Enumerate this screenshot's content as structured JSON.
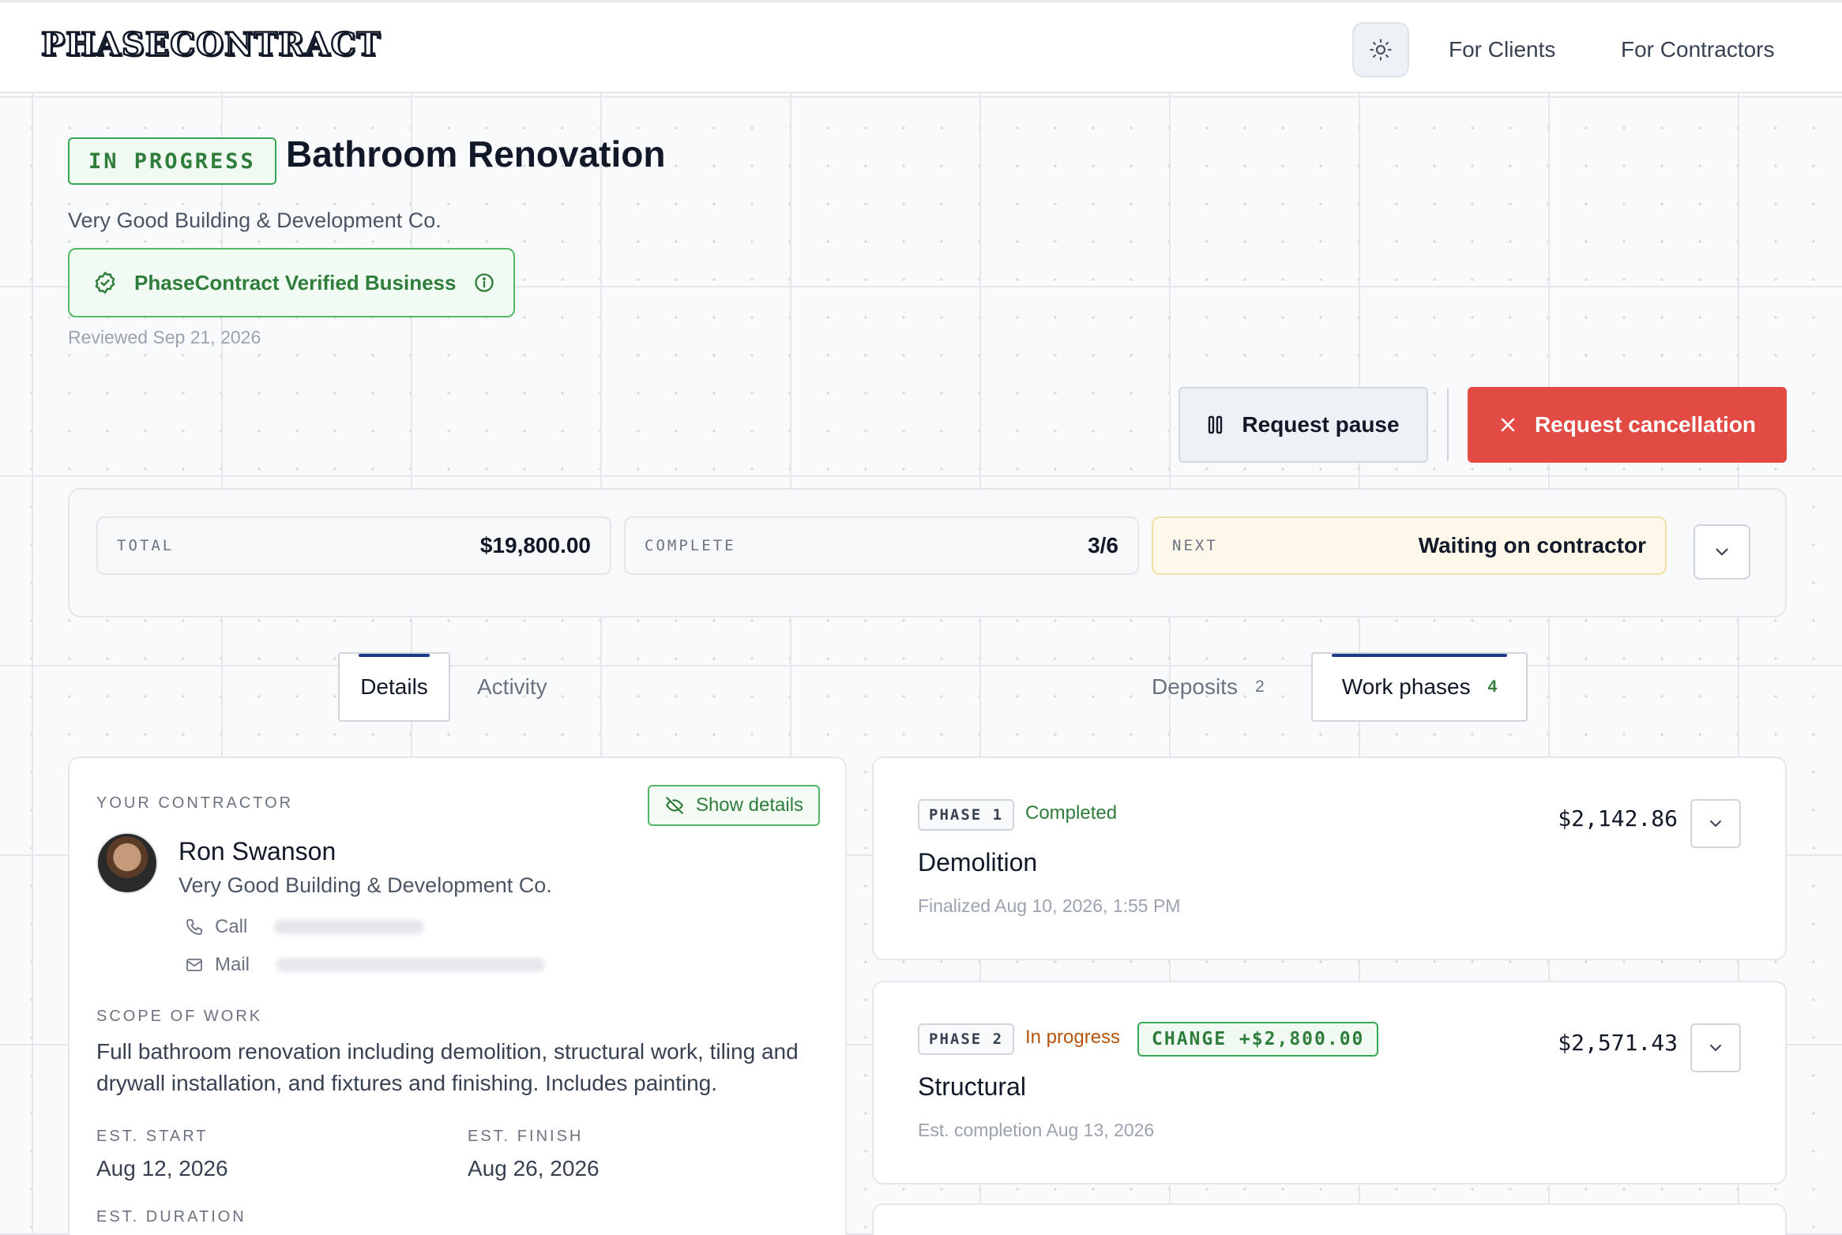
{
  "header": {
    "logo": "PHASECONTRACT",
    "nav": [
      {
        "label": "For Clients"
      },
      {
        "label": "For Contractors"
      }
    ]
  },
  "project": {
    "status": "IN PROGRESS",
    "title": "Bathroom Renovation",
    "company": "Very Good Building & Development Co.",
    "verified_label": "PhaseContract Verified Business",
    "reviewed": "Reviewed Sep 21, 2026"
  },
  "actions": {
    "pause": "Request pause",
    "cancel": "Request cancellation"
  },
  "stats": {
    "total_label": "TOTAL",
    "total_value": "$19,800.00",
    "complete_label": "COMPLETE",
    "complete_value": "3/6",
    "next_label": "NEXT",
    "next_value": "Waiting on contractor"
  },
  "tabs": {
    "details": "Details",
    "activity": "Activity",
    "deposits": "Deposits",
    "deposits_count": "2",
    "work_phases": "Work phases",
    "work_phases_count": "4"
  },
  "contractor": {
    "section_label": "YOUR CONTRACTOR",
    "show_details": "Show details",
    "name": "Ron Swanson",
    "company": "Very Good Building & Development Co.",
    "call_label": "Call",
    "mail_label": "Mail",
    "scope_label": "SCOPE OF WORK",
    "scope_text": "Full bathroom renovation including demolition, structural work, tiling and drywall installation, and fixtures and finishing. Includes painting.",
    "start_label": "EST. START",
    "start_value": "Aug 12, 2026",
    "finish_label": "EST. FINISH",
    "finish_value": "Aug 26, 2026",
    "duration_label": "EST. DURATION"
  },
  "phases": [
    {
      "tag": "PHASE 1",
      "status": "Completed",
      "name": "Demolition",
      "subtitle": "Finalized Aug 10, 2026, 1:55 PM",
      "amount": "$2,142.86"
    },
    {
      "tag": "PHASE 2",
      "status": "In progress",
      "change": "CHANGE +$2,800.00",
      "name": "Structural",
      "subtitle": "Est. completion Aug 13, 2026",
      "amount": "$2,571.43"
    }
  ],
  "colors": {
    "accent_green": "#2f7d3a",
    "danger": "#e14b44",
    "tab_indicator": "#1e3a8a",
    "warning_bg": "#fdf8ea"
  }
}
